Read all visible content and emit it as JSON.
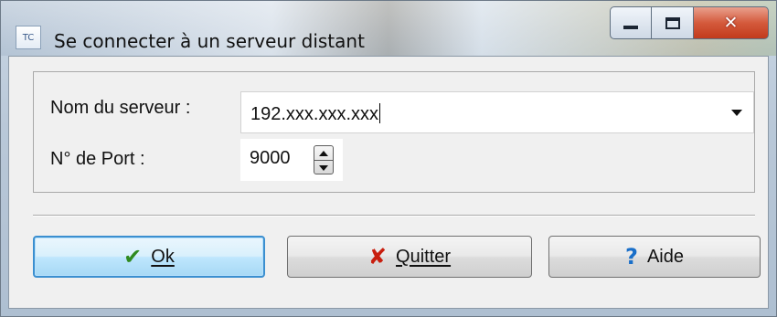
{
  "window": {
    "title": "Se connecter à un serveur distant",
    "app_icon_text": "TC"
  },
  "form": {
    "server_label": "Nom du serveur :",
    "server_value": "192.xxx.xxx.xxx",
    "port_label": "N° de Port :",
    "port_value": "9000"
  },
  "buttons": {
    "ok": "Ok",
    "quit": "Quitter",
    "help": "Aide"
  },
  "icons": {
    "ok": "check-icon",
    "quit": "x-icon",
    "help": "question-icon"
  },
  "colors": {
    "ok_icon": "#2f8a1e",
    "quit_icon": "#c81e0e",
    "help_icon": "#1a6fc9",
    "close_button": "#c23a1c",
    "default_button_border": "#3b8fd0"
  }
}
